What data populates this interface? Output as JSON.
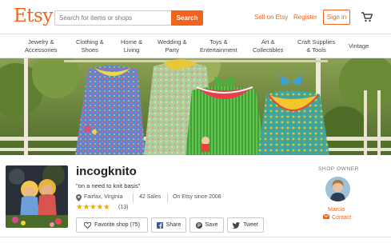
{
  "header": {
    "logo": "Etsy",
    "search_placeholder": "Search for items or shops",
    "search_button": "Search",
    "sell_link": "Sell on Etsy",
    "register_link": "Register",
    "signin_button": "Sign in",
    "cart_icon": "shopping-cart-icon"
  },
  "categories": [
    {
      "line1": "Jewelry &",
      "line2": "Accessories"
    },
    {
      "line1": "Clothing &",
      "line2": "Shoes"
    },
    {
      "line1": "Home &",
      "line2": "Living"
    },
    {
      "line1": "Wedding &",
      "line2": "Party"
    },
    {
      "line1": "Toys &",
      "line2": "Entertainment"
    },
    {
      "line1": "Art &",
      "line2": "Collectibles"
    },
    {
      "line1": "Craft Supplies",
      "line2": "& Tools"
    },
    {
      "line1": "Vintage",
      "line2": ""
    }
  ],
  "shop": {
    "name": "incogknito",
    "tagline": "\"on a need to knit basis\"",
    "location": "Fairfax, Virginia",
    "sales": "42 Sales",
    "since": "On Etsy since 2008",
    "stars": "★★★★★",
    "reviews": "(13)",
    "rating": 5
  },
  "actions": {
    "favorite": "Favorite shop (75)",
    "share": "Share",
    "save": "Save",
    "tweet": "Tweet"
  },
  "owner": {
    "label": "SHOP OWNER",
    "name": "Marcia",
    "contact": "Contact"
  },
  "colors": {
    "brand": "#f1641e",
    "star": "#f1a80a"
  }
}
